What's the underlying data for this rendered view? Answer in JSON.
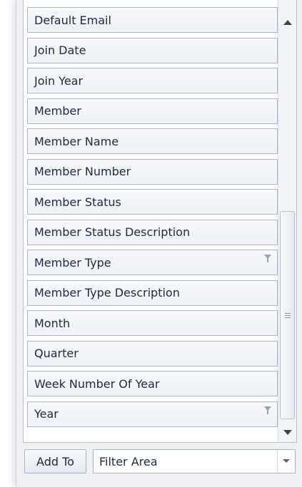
{
  "field_list": {
    "items": [
      {
        "label": "Default Email",
        "filtered": false
      },
      {
        "label": "Join Date",
        "filtered": false
      },
      {
        "label": "Join Year",
        "filtered": false
      },
      {
        "label": "Member",
        "filtered": false
      },
      {
        "label": "Member Name",
        "filtered": false
      },
      {
        "label": "Member Number",
        "filtered": false
      },
      {
        "label": "Member Status",
        "filtered": false
      },
      {
        "label": "Member Status Description",
        "filtered": false
      },
      {
        "label": "Member Type",
        "filtered": true
      },
      {
        "label": "Member Type Description",
        "filtered": false
      },
      {
        "label": "Month",
        "filtered": false
      },
      {
        "label": "Quarter",
        "filtered": false
      },
      {
        "label": "Week Number Of Year",
        "filtered": false
      },
      {
        "label": "Year",
        "filtered": true
      }
    ],
    "filter_icon": "funnel-icon"
  },
  "scrollbar": {
    "up_icon": "arrow-up-icon",
    "down_icon": "arrow-down-icon",
    "grip_icon": "grip-icon"
  },
  "bottom_bar": {
    "add_to_label": "Add To",
    "area_value": "Filter Area",
    "dropdown_icon": "chevron-down-icon"
  },
  "colors": {
    "panel_bg": "#eef0f4",
    "field_border": "#aab4c4",
    "text": "#1e2a3a"
  }
}
